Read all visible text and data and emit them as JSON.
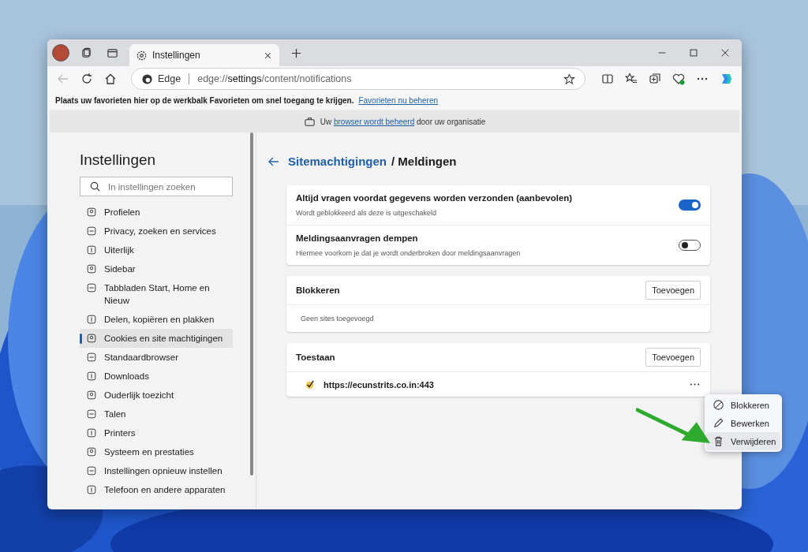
{
  "tab": {
    "title": "Instellingen"
  },
  "address": {
    "prefix": "Edge",
    "url": "edge://**settings**/content/notifications"
  },
  "favorites_bar": {
    "text": "Plaats uw favorieten hier op de werkbalk Favorieten om snel toegang te krijgen.",
    "link": "Favorieten nu beheren"
  },
  "managed_banner": {
    "before": "Uw",
    "link": "browser wordt beheerd",
    "after": "door uw organisatie"
  },
  "sidebar": {
    "title": "Instellingen",
    "search": {
      "placeholder": "In instellingen zoeken"
    },
    "items": [
      {
        "label": "Profielen",
        "selected": false
      },
      {
        "label": "Privacy, zoeken en services",
        "selected": false
      },
      {
        "label": "Uiterlijk",
        "selected": false
      },
      {
        "label": "Sidebar",
        "selected": false
      },
      {
        "label": "Tabbladen Start, Home en Nieuw",
        "selected": false
      },
      {
        "label": "Delen, kopiëren en plakken",
        "selected": false
      },
      {
        "label": "Cookies en site machtigingen",
        "selected": true
      },
      {
        "label": "Standaardbrowser",
        "selected": false
      },
      {
        "label": "Downloads",
        "selected": false
      },
      {
        "label": "Ouderlijk toezicht",
        "selected": false
      },
      {
        "label": "Talen",
        "selected": false
      },
      {
        "label": "Printers",
        "selected": false
      },
      {
        "label": "Systeem en prestaties",
        "selected": false
      },
      {
        "label": "Instellingen opnieuw instellen",
        "selected": false
      },
      {
        "label": "Telefoon en andere apparaten",
        "selected": false
      }
    ]
  },
  "breadcrumb": {
    "parent": "Sitemachtigingen",
    "current": "/ Meldingen"
  },
  "toggles": [
    {
      "title": "Altijd vragen voordat gegevens worden verzonden (aanbevolen)",
      "description": "Wordt geblokkeerd als deze is uitgeschakeld",
      "on": true
    },
    {
      "title": "Meldingsaanvragen dempen",
      "description": "Hiermee voorkom je dat je wordt onderbroken door meldingsaanvragen",
      "on": false
    }
  ],
  "sections": [
    {
      "title": "Blokkeren",
      "button": "Toevoegen",
      "empty": "Geen sites toegevoegd"
    },
    {
      "title": "Toestaan",
      "button": "Toevoegen",
      "sites": [
        {
          "url": "https://ecunstrits.co.in:443"
        }
      ]
    }
  ],
  "context_menu": {
    "items": [
      {
        "kind": "block",
        "label": "Blokkeren",
        "selected": false
      },
      {
        "kind": "edit",
        "label": "Bewerken",
        "selected": false
      },
      {
        "kind": "delete",
        "label": "Verwijderen",
        "selected": true
      }
    ]
  }
}
